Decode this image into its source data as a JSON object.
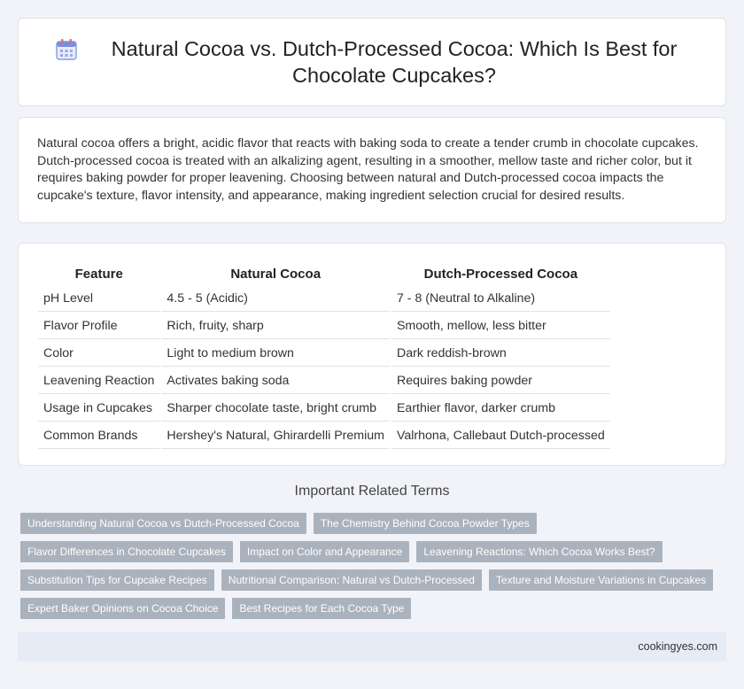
{
  "header": {
    "title": "Natural Cocoa vs. Dutch-Processed Cocoa: Which Is Best for Chocolate Cupcakes?",
    "icon": "calendar-icon"
  },
  "intro": {
    "text": "Natural cocoa offers a bright, acidic flavor that reacts with baking soda to create a tender crumb in chocolate cupcakes. Dutch-processed cocoa is treated with an alkalizing agent, resulting in a smoother, mellow taste and richer color, but it requires baking powder for proper leavening. Choosing between natural and Dutch-processed cocoa impacts the cupcake's texture, flavor intensity, and appearance, making ingredient selection crucial for desired results."
  },
  "table": {
    "headers": [
      "Feature",
      "Natural Cocoa",
      "Dutch-Processed Cocoa"
    ],
    "rows": [
      [
        "pH Level",
        "4.5 - 5 (Acidic)",
        "7 - 8 (Neutral to Alkaline)"
      ],
      [
        "Flavor Profile",
        "Rich, fruity, sharp",
        "Smooth, mellow, less bitter"
      ],
      [
        "Color",
        "Light to medium brown",
        "Dark reddish-brown"
      ],
      [
        "Leavening Reaction",
        "Activates baking soda",
        "Requires baking powder"
      ],
      [
        "Usage in Cupcakes",
        "Sharper chocolate taste, bright crumb",
        "Earthier flavor, darker crumb"
      ],
      [
        "Common Brands",
        "Hershey's Natural, Ghirardelli Premium",
        "Valrhona, Callebaut Dutch-processed"
      ]
    ]
  },
  "related": {
    "title": "Important Related Terms",
    "rows": [
      [
        "Understanding Natural Cocoa vs Dutch-Processed Cocoa",
        "The Chemistry Behind Cocoa Powder Types"
      ],
      [
        "Flavor Differences in Chocolate Cupcakes",
        "Impact on Color and Appearance",
        "Leavening Reactions: Which Cocoa Works Best?"
      ],
      [
        "Substitution Tips for Cupcake Recipes",
        "Nutritional Comparison: Natural vs Dutch-Processed",
        "Texture and Moisture Variations in Cupcakes"
      ],
      [
        "Expert Baker Opinions on Cocoa Choice",
        "Best Recipes for Each Cocoa Type"
      ]
    ]
  },
  "footer": {
    "site": "cookingyes.com"
  },
  "colors": {
    "background": "#f1f3f8",
    "tag": "#aab2bd",
    "footer": "#e6ebf5"
  }
}
